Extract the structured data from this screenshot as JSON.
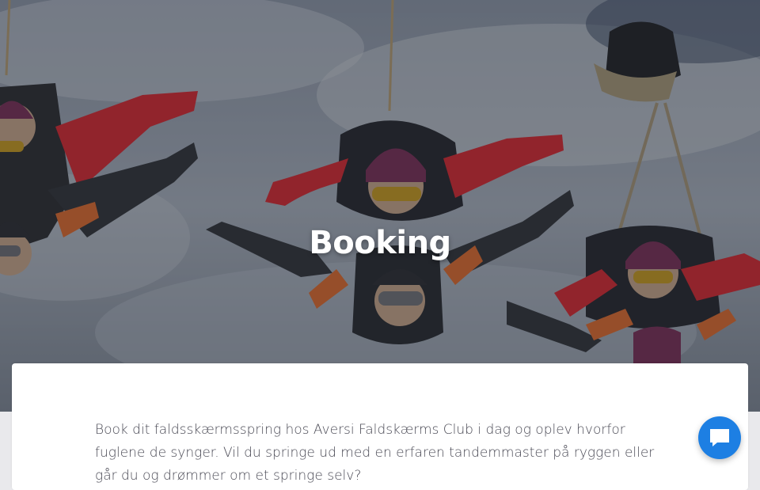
{
  "hero": {
    "title": "Booking",
    "image_description_icon": "skydivers-photo"
  },
  "content": {
    "intro": "Book dit faldsskærmsspring hos Aversi Faldskærms Club i dag og oplev hvorfor fuglene de synger. Vil du springe ud med en erfaren tandemmaster på ryggen eller går du og drømmer om et springe selv?"
  },
  "chat": {
    "icon": "chat-bubble-icon"
  },
  "colors": {
    "accent": "#1d7fe3",
    "jumpsuit_red": "#d8262e",
    "sky_overlay": "#5d6470",
    "text": "#4a4a55"
  }
}
